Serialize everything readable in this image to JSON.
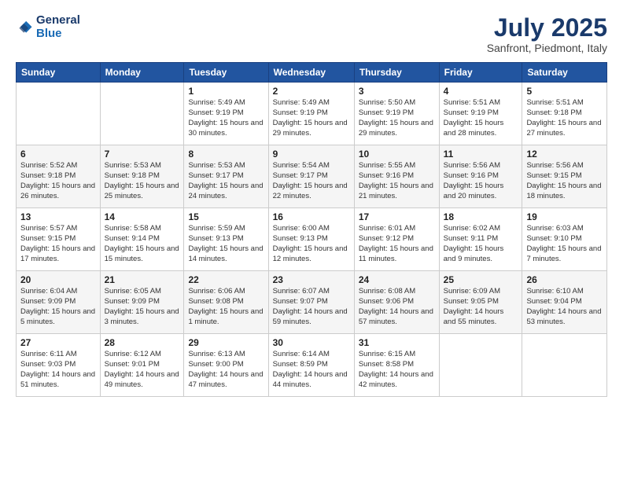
{
  "header": {
    "logo_line1": "General",
    "logo_line2": "Blue",
    "month_title": "July 2025",
    "location": "Sanfront, Piedmont, Italy"
  },
  "weekdays": [
    "Sunday",
    "Monday",
    "Tuesday",
    "Wednesday",
    "Thursday",
    "Friday",
    "Saturday"
  ],
  "weeks": [
    [
      {
        "day": "",
        "info": ""
      },
      {
        "day": "",
        "info": ""
      },
      {
        "day": "1",
        "info": "Sunrise: 5:49 AM\nSunset: 9:19 PM\nDaylight: 15 hours\nand 30 minutes."
      },
      {
        "day": "2",
        "info": "Sunrise: 5:49 AM\nSunset: 9:19 PM\nDaylight: 15 hours\nand 29 minutes."
      },
      {
        "day": "3",
        "info": "Sunrise: 5:50 AM\nSunset: 9:19 PM\nDaylight: 15 hours\nand 29 minutes."
      },
      {
        "day": "4",
        "info": "Sunrise: 5:51 AM\nSunset: 9:19 PM\nDaylight: 15 hours\nand 28 minutes."
      },
      {
        "day": "5",
        "info": "Sunrise: 5:51 AM\nSunset: 9:18 PM\nDaylight: 15 hours\nand 27 minutes."
      }
    ],
    [
      {
        "day": "6",
        "info": "Sunrise: 5:52 AM\nSunset: 9:18 PM\nDaylight: 15 hours\nand 26 minutes."
      },
      {
        "day": "7",
        "info": "Sunrise: 5:53 AM\nSunset: 9:18 PM\nDaylight: 15 hours\nand 25 minutes."
      },
      {
        "day": "8",
        "info": "Sunrise: 5:53 AM\nSunset: 9:17 PM\nDaylight: 15 hours\nand 24 minutes."
      },
      {
        "day": "9",
        "info": "Sunrise: 5:54 AM\nSunset: 9:17 PM\nDaylight: 15 hours\nand 22 minutes."
      },
      {
        "day": "10",
        "info": "Sunrise: 5:55 AM\nSunset: 9:16 PM\nDaylight: 15 hours\nand 21 minutes."
      },
      {
        "day": "11",
        "info": "Sunrise: 5:56 AM\nSunset: 9:16 PM\nDaylight: 15 hours\nand 20 minutes."
      },
      {
        "day": "12",
        "info": "Sunrise: 5:56 AM\nSunset: 9:15 PM\nDaylight: 15 hours\nand 18 minutes."
      }
    ],
    [
      {
        "day": "13",
        "info": "Sunrise: 5:57 AM\nSunset: 9:15 PM\nDaylight: 15 hours\nand 17 minutes."
      },
      {
        "day": "14",
        "info": "Sunrise: 5:58 AM\nSunset: 9:14 PM\nDaylight: 15 hours\nand 15 minutes."
      },
      {
        "day": "15",
        "info": "Sunrise: 5:59 AM\nSunset: 9:13 PM\nDaylight: 15 hours\nand 14 minutes."
      },
      {
        "day": "16",
        "info": "Sunrise: 6:00 AM\nSunset: 9:13 PM\nDaylight: 15 hours\nand 12 minutes."
      },
      {
        "day": "17",
        "info": "Sunrise: 6:01 AM\nSunset: 9:12 PM\nDaylight: 15 hours\nand 11 minutes."
      },
      {
        "day": "18",
        "info": "Sunrise: 6:02 AM\nSunset: 9:11 PM\nDaylight: 15 hours\nand 9 minutes."
      },
      {
        "day": "19",
        "info": "Sunrise: 6:03 AM\nSunset: 9:10 PM\nDaylight: 15 hours\nand 7 minutes."
      }
    ],
    [
      {
        "day": "20",
        "info": "Sunrise: 6:04 AM\nSunset: 9:09 PM\nDaylight: 15 hours\nand 5 minutes."
      },
      {
        "day": "21",
        "info": "Sunrise: 6:05 AM\nSunset: 9:09 PM\nDaylight: 15 hours\nand 3 minutes."
      },
      {
        "day": "22",
        "info": "Sunrise: 6:06 AM\nSunset: 9:08 PM\nDaylight: 15 hours\nand 1 minute."
      },
      {
        "day": "23",
        "info": "Sunrise: 6:07 AM\nSunset: 9:07 PM\nDaylight: 14 hours\nand 59 minutes."
      },
      {
        "day": "24",
        "info": "Sunrise: 6:08 AM\nSunset: 9:06 PM\nDaylight: 14 hours\nand 57 minutes."
      },
      {
        "day": "25",
        "info": "Sunrise: 6:09 AM\nSunset: 9:05 PM\nDaylight: 14 hours\nand 55 minutes."
      },
      {
        "day": "26",
        "info": "Sunrise: 6:10 AM\nSunset: 9:04 PM\nDaylight: 14 hours\nand 53 minutes."
      }
    ],
    [
      {
        "day": "27",
        "info": "Sunrise: 6:11 AM\nSunset: 9:03 PM\nDaylight: 14 hours\nand 51 minutes."
      },
      {
        "day": "28",
        "info": "Sunrise: 6:12 AM\nSunset: 9:01 PM\nDaylight: 14 hours\nand 49 minutes."
      },
      {
        "day": "29",
        "info": "Sunrise: 6:13 AM\nSunset: 9:00 PM\nDaylight: 14 hours\nand 47 minutes."
      },
      {
        "day": "30",
        "info": "Sunrise: 6:14 AM\nSunset: 8:59 PM\nDaylight: 14 hours\nand 44 minutes."
      },
      {
        "day": "31",
        "info": "Sunrise: 6:15 AM\nSunset: 8:58 PM\nDaylight: 14 hours\nand 42 minutes."
      },
      {
        "day": "",
        "info": ""
      },
      {
        "day": "",
        "info": ""
      }
    ]
  ]
}
